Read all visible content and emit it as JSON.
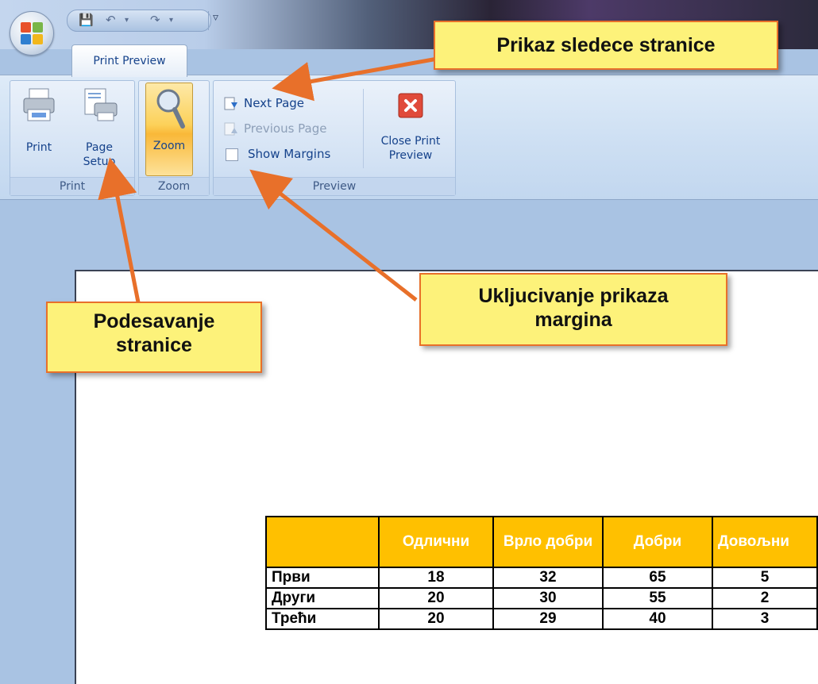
{
  "window": {
    "quick_access": {
      "save_icon": "save-icon",
      "undo_icon": "undo-icon",
      "redo_icon": "redo-icon",
      "customize_icon": "dropdown-icon"
    },
    "active_tab": "Print Preview"
  },
  "ribbon": {
    "print_group": {
      "label": "Print",
      "print_button": "Print",
      "page_setup_line1": "Page",
      "page_setup_line2": "Setup"
    },
    "zoom_group": {
      "label": "Zoom",
      "zoom_button": "Zoom"
    },
    "preview_group": {
      "label": "Preview",
      "next_page": "Next Page",
      "previous_page": "Previous Page",
      "show_margins": "Show Margins",
      "show_margins_checked": false,
      "close_line1": "Close Print",
      "close_line2": "Preview"
    }
  },
  "table": {
    "headers": [
      "",
      "Одлични",
      "Врло добри",
      "Добри",
      "Довољни"
    ],
    "rows": [
      {
        "label": "Први",
        "values": [
          "18",
          "32",
          "65",
          "5"
        ]
      },
      {
        "label": "Други",
        "values": [
          "20",
          "30",
          "55",
          "2"
        ]
      },
      {
        "label": "Трећи",
        "values": [
          "20",
          "29",
          "40",
          "3"
        ]
      }
    ]
  },
  "callouts": {
    "next_page": "Prikaz sledece stranice",
    "page_setup_line1": "Podesavanje",
    "page_setup_line2": "stranice",
    "margins_line1": "Ukljucivanje prikaza",
    "margins_line2": "margina"
  },
  "colors": {
    "header_fill": "#ffc000",
    "callout_fill": "#fdf27a",
    "callout_border": "#e8702a",
    "ribbon_text": "#15428b"
  }
}
